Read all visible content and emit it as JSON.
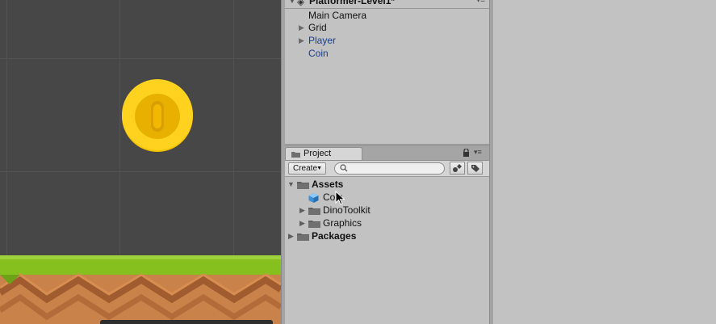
{
  "colors": {
    "scene_background": "#474747",
    "prefab_text": "#1a3e8c",
    "coin_gold": "#f7c200",
    "grass": "#86c01e",
    "dirt": "#c9824a"
  },
  "scene": {
    "coin_icon": "coin-sprite",
    "ground_icon": "ground-tiles"
  },
  "hierarchy": {
    "scene_name": "Platformer-Level1*",
    "items": [
      {
        "label": "Main Camera",
        "expandable": false,
        "prefab": false
      },
      {
        "label": "Grid",
        "expandable": true,
        "prefab": false
      },
      {
        "label": "Player",
        "expandable": true,
        "prefab": true
      },
      {
        "label": "Coin",
        "expandable": false,
        "prefab": true
      }
    ]
  },
  "project": {
    "tab_label": "Project",
    "create_label": "Create",
    "search_placeholder": "",
    "tree": [
      {
        "label": "Assets",
        "expanded": true,
        "icon": "folder-icon"
      },
      {
        "label": "Coin",
        "icon": "prefab-cube-icon"
      },
      {
        "label": "DinoToolkit",
        "expanded": false,
        "icon": "folder-icon"
      },
      {
        "label": "Graphics",
        "expanded": false,
        "icon": "folder-icon"
      },
      {
        "label": "Packages",
        "expanded": false,
        "icon": "folder-icon"
      }
    ]
  }
}
